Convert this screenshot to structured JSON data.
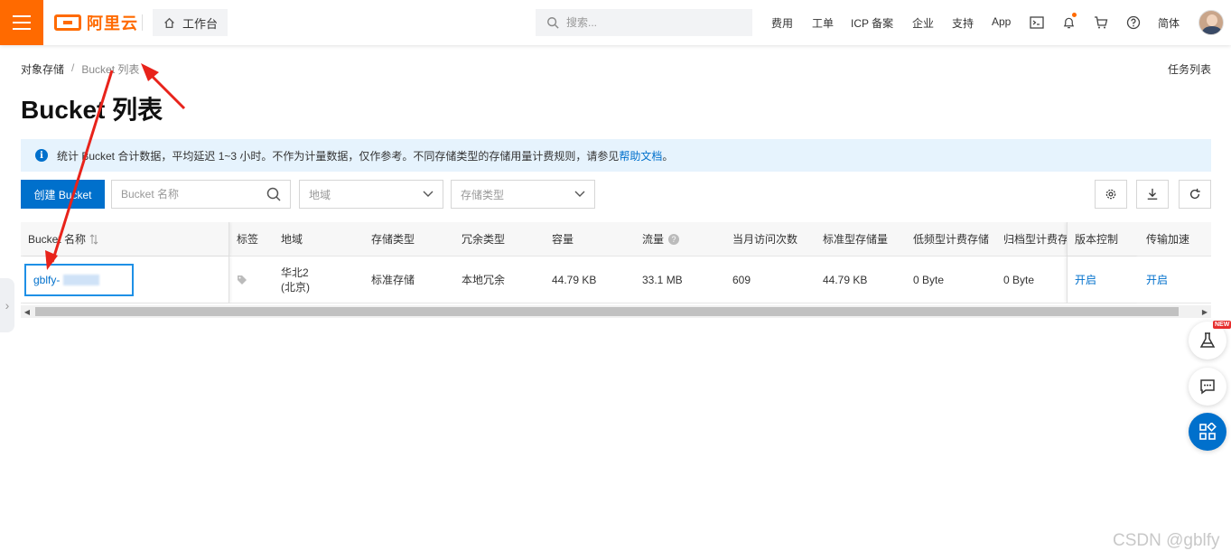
{
  "topbar": {
    "logo_text": "阿里云",
    "workbench_label": "工作台",
    "search_placeholder": "搜索...",
    "nav_items": [
      "费用",
      "工单",
      "ICP 备案",
      "企业",
      "支持",
      "App"
    ],
    "language": "简体"
  },
  "breadcrumb": {
    "root": "对象存储",
    "separator": "/",
    "current": "Bucket 列表"
  },
  "task_list_label": "任务列表",
  "page_title": "Bucket 列表",
  "notice": {
    "text": "统计 Bucket 合计数据，平均延迟 1~3 小时。不作为计量数据，仅作参考。不同存储类型的存储用量计费规则，请参见",
    "link": "帮助文档",
    "suffix": "。"
  },
  "toolbar": {
    "create_label": "创建 Bucket",
    "name_placeholder": "Bucket 名称",
    "region_placeholder": "地域",
    "storage_type_placeholder": "存储类型"
  },
  "table": {
    "columns": [
      "Bucket 名称",
      "标签",
      "地域",
      "存储类型",
      "冗余类型",
      "容量",
      "流量",
      "当月访问次数",
      "标准型存储量",
      "低频型计费存储",
      "归档型计费存",
      "版本控制",
      "传输加速"
    ],
    "row": {
      "name": "gblfy-",
      "region_line1": "华北2",
      "region_line2": "(北京)",
      "storage_type": "标准存储",
      "redundancy": "本地冗余",
      "capacity": "44.79 KB",
      "traffic": "33.1 MB",
      "monthly_visits": "609",
      "standard_storage": "44.79 KB",
      "ia_storage": "0 Byte",
      "archive_storage": "0 Byte",
      "versioning": "开启",
      "transfer_accel": "开启"
    }
  },
  "float": {
    "new_badge": "NEW"
  },
  "watermark": "CSDN @gblfy",
  "colors": {
    "brand": "#ff6a00",
    "primary": "#0070cc",
    "notice_bg": "#e6f3fd",
    "annotation": "#e8231b"
  }
}
